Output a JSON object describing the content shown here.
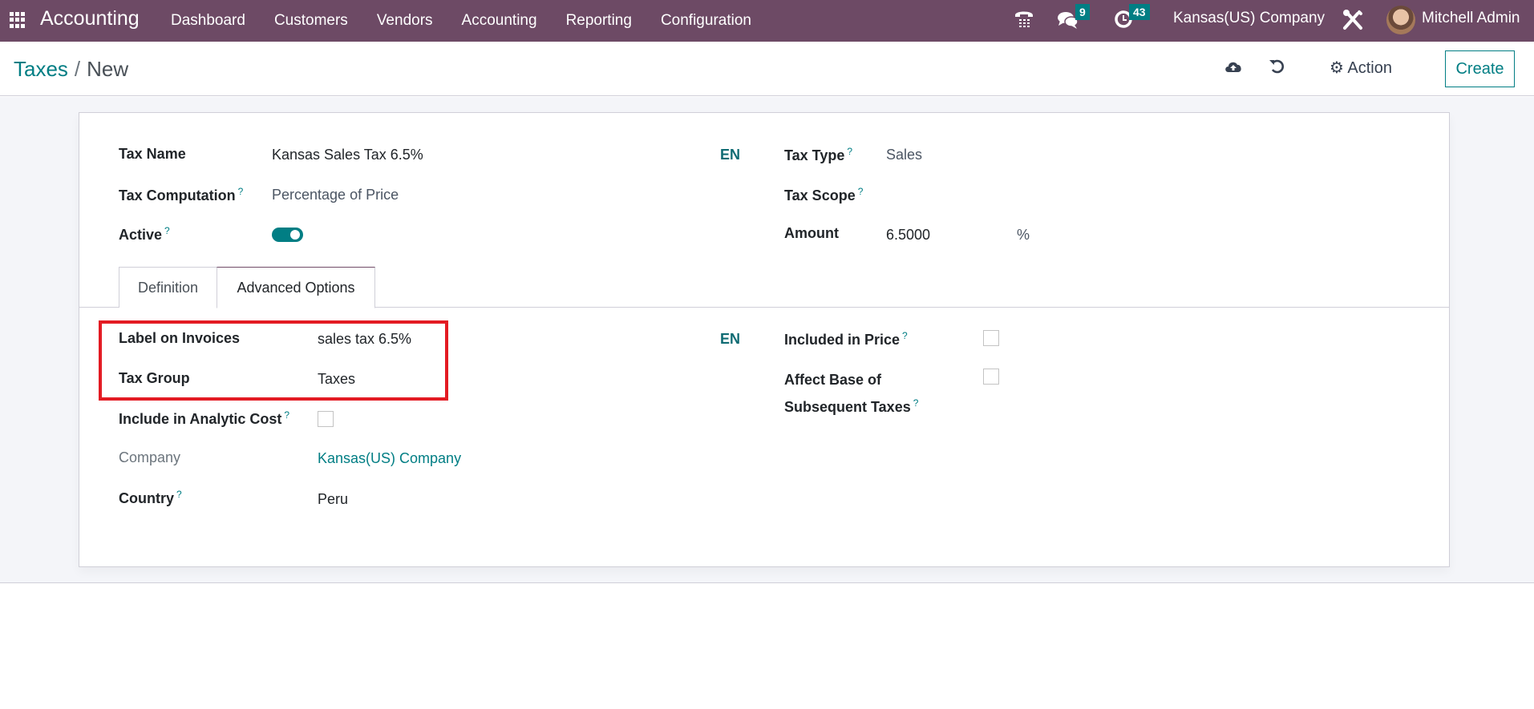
{
  "navbar": {
    "app_name": "Accounting",
    "menu": [
      "Dashboard",
      "Customers",
      "Vendors",
      "Accounting",
      "Reporting",
      "Configuration"
    ],
    "icons": {
      "apps": "apps-grid-icon",
      "phone": "phone-icon",
      "messages": "chat-icon",
      "activities": "clock-icon",
      "settings": "tools-icon"
    },
    "messages_count": "9",
    "activities_count": "43",
    "company": "Kansas(US) Company",
    "user": "Mitchell Admin"
  },
  "control_panel": {
    "breadcrumb_parent": "Taxes",
    "breadcrumb_separator": "/",
    "breadcrumb_current": "New",
    "save_icon": "cloud-upload-icon",
    "discard_icon": "undo-icon",
    "action_label": "Action",
    "create_label": "Create"
  },
  "form": {
    "tax_name_label": "Tax Name",
    "tax_name_value": "Kansas Sales Tax 6.5%",
    "tax_computation_label": "Tax Computation",
    "tax_computation_value": "Percentage of Price",
    "active_label": "Active",
    "active_value": true,
    "lang_label": "EN",
    "tax_type_label": "Tax Type",
    "tax_type_value": "Sales",
    "tax_scope_label": "Tax Scope",
    "tax_scope_value": "",
    "amount_label": "Amount",
    "amount_value": "6.5000",
    "amount_unit": "%",
    "help_mark": "?",
    "tabs": [
      {
        "label": "Definition",
        "active": false
      },
      {
        "label": "Advanced Options",
        "active": true
      }
    ],
    "advanced": {
      "label_on_invoices_label": "Label on Invoices",
      "label_on_invoices_value": "sales tax 6.5%",
      "tax_group_label": "Tax Group",
      "tax_group_value": "Taxes",
      "include_analytic_label": "Include in Analytic Cost",
      "include_analytic_value": false,
      "company_label": "Company",
      "company_value": "Kansas(US) Company",
      "country_label": "Country",
      "country_value": "Peru",
      "lang_label": "EN",
      "included_in_price_label": "Included in Price",
      "included_in_price_value": false,
      "affect_base_label_line1": "Affect Base of",
      "affect_base_label_line2": "Subsequent Taxes",
      "affect_base_value": false
    }
  },
  "colors": {
    "navbar": "#6d4a65",
    "accent": "#017e84",
    "highlight": "#e31b23"
  }
}
